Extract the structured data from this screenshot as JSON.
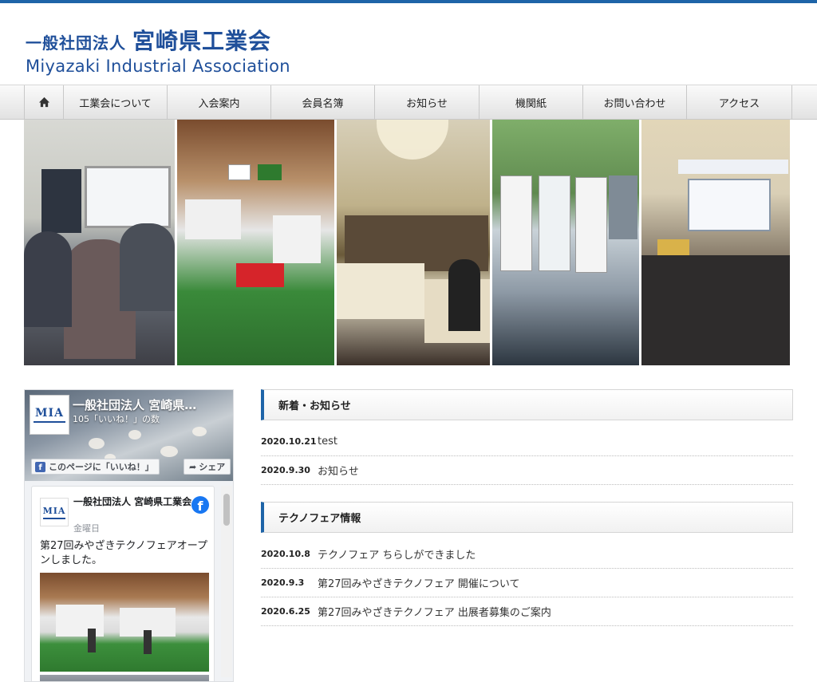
{
  "header": {
    "logo_prefix": "一般社団法人",
    "logo_name": "宮崎県工業会",
    "logo_english": "Miyazaki Industrial Association"
  },
  "nav": {
    "home_icon": "home-icon",
    "items": [
      "工業会について",
      "入会案内",
      "会員名簿",
      "お知らせ",
      "機関紙",
      "お問い合わせ",
      "アクセス"
    ]
  },
  "facebook": {
    "page_name": "一般社団法人 宮崎県…",
    "likes": "105「いいね！」の数",
    "like_button": "このページに「いいね！」",
    "share_button": "シェア",
    "logo_text": "MIA",
    "post": {
      "title": "一般社団法人 宮崎県工業会",
      "date": "金曜日",
      "text": "第27回みやざきテクノフェアオープンしました。"
    }
  },
  "news": {
    "title": "新着・お知らせ",
    "items": [
      {
        "date": "2020.10.21",
        "title": "test"
      },
      {
        "date": "2020.9.30",
        "title": "お知らせ"
      }
    ]
  },
  "technofair": {
    "title": "テクノフェア情報",
    "items": [
      {
        "date": "2020.10.8",
        "title": "テクノフェア ちらしができました"
      },
      {
        "date": "2020.9.3",
        "title": "第27回みやざきテクノフェア 開催について"
      },
      {
        "date": "2020.6.25",
        "title": "第27回みやざきテクノフェア 出展者募集のご案内"
      }
    ]
  },
  "colors": {
    "brand": "#1f4f9a",
    "accent": "#1e64a8",
    "facebook": "#1877f2"
  }
}
